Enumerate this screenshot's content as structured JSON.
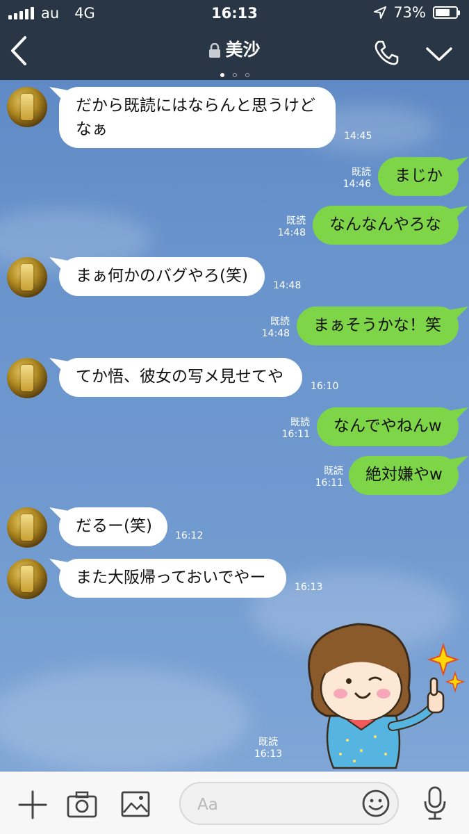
{
  "status_bar": {
    "carrier": "au",
    "network": "4G",
    "time": "16:13",
    "battery": "73%",
    "battery_level": 0.73
  },
  "header": {
    "title": "美沙",
    "page_count": 3,
    "active_page": 0
  },
  "messages": [
    {
      "dir": "in",
      "text_lines": [
        "だから既読にはならんと思うけど",
        "なぁ"
      ],
      "time": "14:45"
    },
    {
      "dir": "out",
      "text": "まじか",
      "read": "既読",
      "time": "14:46"
    },
    {
      "dir": "out",
      "text": "なんなんやろな",
      "read": "既読",
      "time": "14:48"
    },
    {
      "dir": "in",
      "text": "まぁ何かのバグやろ(笑)",
      "time": "14:48"
    },
    {
      "dir": "out",
      "text": "まぁそうかな！笑",
      "read": "既読",
      "time": "14:48"
    },
    {
      "dir": "in",
      "text": "てか悟、彼女の写メ見せてや",
      "time": "16:10"
    },
    {
      "dir": "out",
      "text": "なんでやねんw",
      "read": "既読",
      "time": "16:11"
    },
    {
      "dir": "out",
      "text": "絶対嫌やw",
      "read": "既読",
      "time": "16:11"
    },
    {
      "dir": "in",
      "text": "だるー(笑)",
      "time": "16:12"
    },
    {
      "dir": "in",
      "text": "また大阪帰っておいでやー",
      "time": "16:13"
    },
    {
      "dir": "out",
      "sticker": "wink-thumbs-up-girl",
      "read": "既読",
      "time": "16:13"
    }
  ],
  "input_bar": {
    "placeholder": "Aa"
  },
  "icons": [
    "back-icon",
    "lock-icon",
    "phone-icon",
    "chevron-down-icon",
    "plus-icon",
    "camera-icon",
    "image-icon",
    "emoji-icon",
    "microphone-icon"
  ],
  "colors": {
    "header_bg": "#283645",
    "sent_bubble": "#7fd548",
    "received_bubble": "#ffffff",
    "chat_bg": "#6893cc"
  }
}
